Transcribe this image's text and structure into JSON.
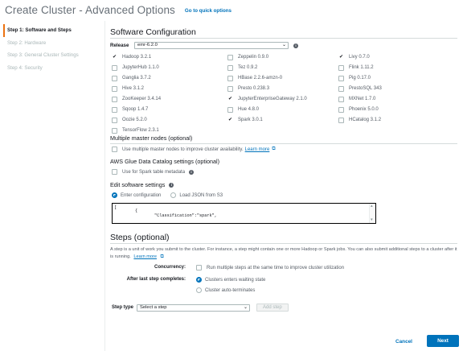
{
  "header": {
    "title": "Create Cluster - Advanced Options",
    "quick_link": "Go to quick options"
  },
  "sidebar": {
    "items": [
      {
        "label": "Step 1: Software and Steps",
        "active": true
      },
      {
        "label": "Step 2: Hardware",
        "active": false
      },
      {
        "label": "Step 3: General Cluster Settings",
        "active": false
      },
      {
        "label": "Step 4: Security",
        "active": false
      }
    ]
  },
  "software": {
    "title": "Software Configuration",
    "release_label": "Release",
    "release_value": "emr-6.2.0",
    "applications": [
      {
        "label": "Hadoop 3.2.1",
        "checked": true
      },
      {
        "label": "Zeppelin 0.9.0",
        "checked": false
      },
      {
        "label": "Livy 0.7.0",
        "checked": true
      },
      {
        "label": "JupyterHub 1.1.0",
        "checked": false
      },
      {
        "label": "Tez 0.9.2",
        "checked": false
      },
      {
        "label": "Flink 1.11.2",
        "checked": false
      },
      {
        "label": "Ganglia 3.7.2",
        "checked": false
      },
      {
        "label": "HBase 2.2.6-amzn-0",
        "checked": false
      },
      {
        "label": "Pig 0.17.0",
        "checked": false
      },
      {
        "label": "Hive 3.1.2",
        "checked": false
      },
      {
        "label": "Presto 0.238.3",
        "checked": false
      },
      {
        "label": "PrestoSQL 343",
        "checked": false
      },
      {
        "label": "ZooKeeper 3.4.14",
        "checked": false
      },
      {
        "label": "JupyterEnterpriseGateway 2.1.0",
        "checked": true
      },
      {
        "label": "MXNet 1.7.0",
        "checked": false
      },
      {
        "label": "Sqoop 1.4.7",
        "checked": false
      },
      {
        "label": "Hue 4.8.0",
        "checked": false
      },
      {
        "label": "Phoenix 5.0.0",
        "checked": false
      },
      {
        "label": "Oozie 5.2.0",
        "checked": false
      },
      {
        "label": "Spark 3.0.1",
        "checked": true
      },
      {
        "label": "HCatalog 3.1.2",
        "checked": false
      },
      {
        "label": "TensorFlow 2.3.1",
        "checked": false
      }
    ],
    "multi_master": {
      "title": "Multiple master nodes (optional)",
      "checkbox_label": "Use multiple master nodes to improve cluster availability.",
      "learn_more": "Learn more"
    },
    "glue": {
      "title": "AWS Glue Data Catalog settings (optional)",
      "checkbox_label": "Use for Spark table metadata"
    },
    "edit": {
      "title": "Edit software settings",
      "enter_config": "Enter configuration",
      "load_json": "Load JSON from S3",
      "code_lines": [
        "[",
        "{",
        "\"Classification\":\"spark\","
      ]
    }
  },
  "steps": {
    "title": "Steps (optional)",
    "description": "A step is a unit of work you submit to the cluster. For instance, a step might contain one or more Hadoop or Spark jobs. You can also submit additional steps to a cluster after it is running.",
    "learn_more": "Learn more",
    "concurrency_label": "Concurrency:",
    "concurrency_option": "Run multiple steps at the same time to improve cluster utilization",
    "after_label": "After last step completes:",
    "after_option1": "Clusters enters waiting state",
    "after_option2": "Cluster auto-terminates",
    "step_type_label": "Step type",
    "step_type_value": "Select a step",
    "add_step": "Add step"
  },
  "footer": {
    "cancel": "Cancel",
    "next": "Next"
  },
  "colors": {
    "accent": "#0073bb",
    "active_marker": "#ec7211"
  }
}
